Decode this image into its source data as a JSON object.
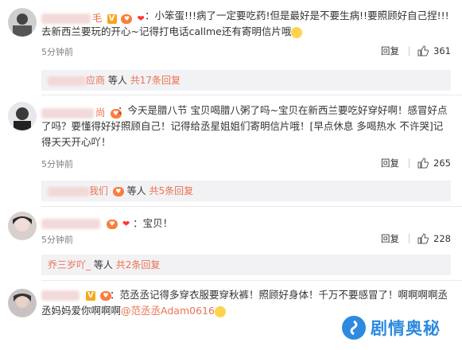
{
  "comments": [
    {
      "name_visible": "毛",
      "text": "：小笨蛋!!!病了一定要吃药!但是最好是不要生病!!要照顾好自己捏!!!去新西兰要玩的开心~记得打电话callme还有寄明信片哦",
      "time": "5分钟前",
      "reply": "回复",
      "likes": "361",
      "more_names": "应商",
      "more_text": "等人",
      "more_count": "共17条回复"
    },
    {
      "name_visible": "尚",
      "text": "：今天是腊八节 宝贝喝腊八粥了吗~宝贝在新西兰要吃好穿好啊！感冒好点了吗？要懂得好好照顾自己！记得给丞星姐姐们寄明信片哦！[早点休息 多喝热水 不许哭]记得天天开心吖！",
      "time": "5分钟前",
      "reply": "回复",
      "likes": "265",
      "more_names": "我们",
      "more_text": "等人",
      "more_count": "共5条回复"
    },
    {
      "name_visible": "",
      "text": "：宝贝！",
      "time": "5分钟前",
      "reply": "回复",
      "likes": "228",
      "more_names": "乔三岁吖_",
      "more_text": "等人",
      "more_count": "共2条回复"
    },
    {
      "name_visible": "",
      "text_before": "：范丞丞记得多穿衣服要穿秋裤！照顾好身体！千万不要感冒了！啊啊啊啊丞丞妈妈爱你啊啊啊",
      "mention": "@范丞丞Adam0616"
    }
  ],
  "watermark": {
    "text": "剧情奥秘"
  },
  "colors": {
    "accent": "#eb7350",
    "meta": "#808080",
    "watermark": "#2d8ae0"
  },
  "icons": {
    "like": "thumb-up-icon",
    "vip": "v-badge-icon",
    "level": "level-badge-icon",
    "logo": "watermark-logo-icon"
  }
}
